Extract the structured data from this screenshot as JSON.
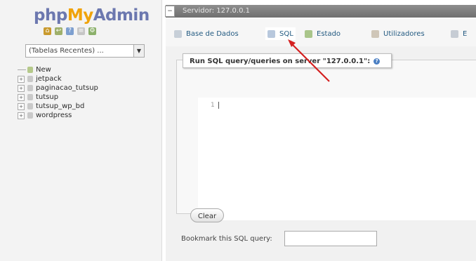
{
  "logo": {
    "php": "php",
    "my": "My",
    "admin": "Admin"
  },
  "nav_icons": [
    "home-icon",
    "exit-icon",
    "query-icon",
    "docs-icon",
    "settings-icon"
  ],
  "recent_select": {
    "value": "(Tabelas Recentes) ..."
  },
  "db_tree": [
    {
      "label": "New",
      "type": "new"
    },
    {
      "label": "jetpack",
      "type": "db"
    },
    {
      "label": "paginacao_tutsup",
      "type": "db"
    },
    {
      "label": "tutsup",
      "type": "db"
    },
    {
      "label": "tutsup_wp_bd",
      "type": "db"
    },
    {
      "label": "wordpress",
      "type": "db"
    }
  ],
  "topbar": {
    "breadcrumb": "Servidor: 127.0.0.1"
  },
  "tabs": [
    {
      "label": "Base de Dados",
      "icon": "database-icon"
    },
    {
      "label": "SQL",
      "icon": "sql-icon",
      "active": true
    },
    {
      "label": "Estado",
      "icon": "status-icon"
    },
    {
      "label": "Utilizadores",
      "icon": "users-icon"
    },
    {
      "label": "E",
      "icon": "export-icon"
    }
  ],
  "sql_panel": {
    "legend": "Run SQL query/queries on server \"127.0.0.1\":",
    "line_number": "1",
    "query_text": ""
  },
  "clear_label": "Clear",
  "bookmark": {
    "label": "Bookmark this SQL query:",
    "value": ""
  },
  "colors": {
    "logo_blue": "#6c78af",
    "logo_orange": "#f0a30a",
    "link_blue": "#235a81",
    "pointer_red": "#d42020"
  }
}
